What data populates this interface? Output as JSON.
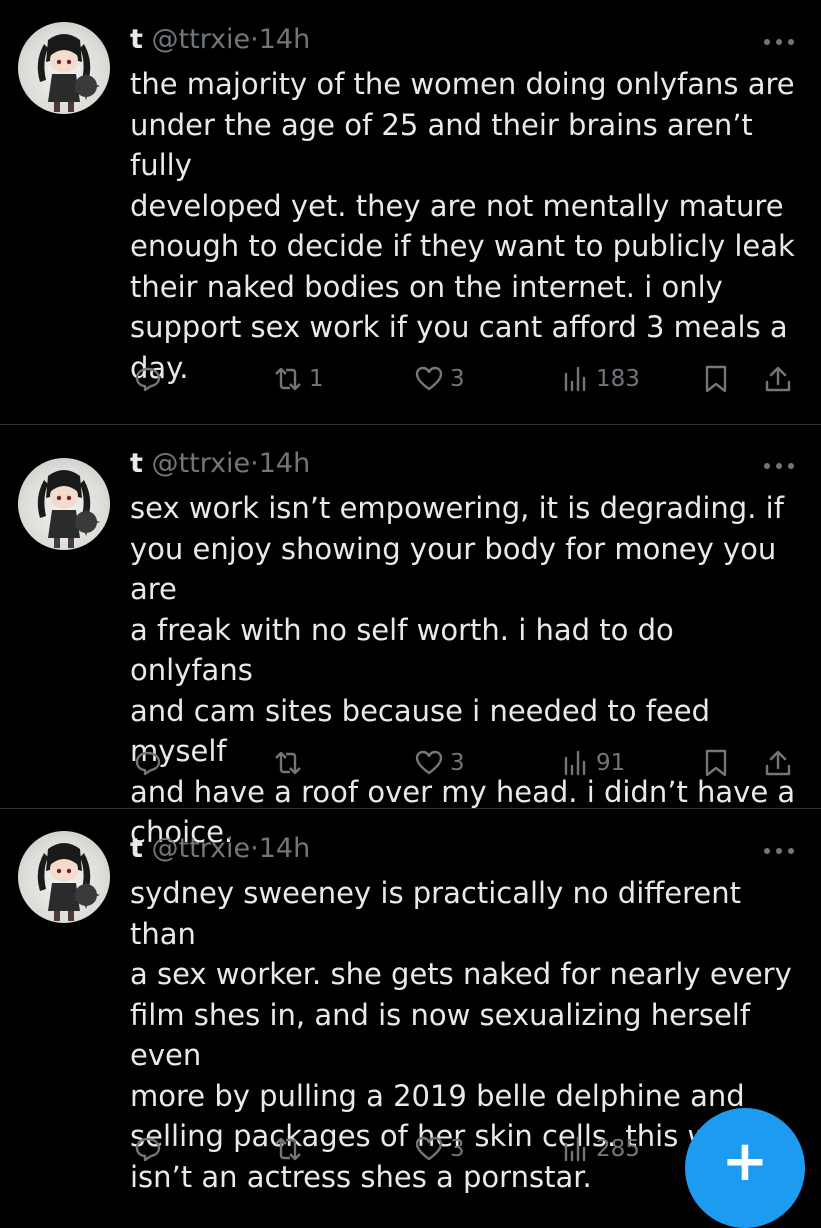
{
  "tweets": [
    {
      "name": "t",
      "handle": "@ttrxie",
      "sep": "·",
      "time": "14h",
      "text": "the majority of the women doing onlyfans are\nunder the age of 25 and their brains aren’t fully\ndeveloped yet. they are not mentally mature\nenough to decide if they want to publicly leak\ntheir naked bodies on the internet. i only\nsupport sex work if you cant afford 3 meals a\nday.",
      "replies": "",
      "reposts": "1",
      "likes": "3",
      "views": "183"
    },
    {
      "name": "t",
      "handle": "@ttrxie",
      "sep": "·",
      "time": "14h",
      "text": "sex work isn’t empowering, it is degrading. if\nyou enjoy showing your body for money you are\na freak with no self worth. i had to do onlyfans\nand cam sites because i needed to feed myself\nand have a roof over my head. i didn’t have a\nchoice.",
      "replies": "",
      "reposts": "",
      "likes": "3",
      "views": "91"
    },
    {
      "name": "t",
      "handle": "@ttrxie",
      "sep": "·",
      "time": "14h",
      "text": "sydney sweeney is practically no different than\na sex worker. she gets naked for nearly every\nfilm shes in, and is now sexualizing herself even\nmore by pulling a 2019 belle delphine and\nselling packages of her skin cells. this woman\nisn’t an actress shes a pornstar.",
      "replies": "",
      "reposts": "",
      "likes": "3",
      "views": "285"
    }
  ],
  "compose_button": {
    "icon": "plus-icon",
    "label": "+"
  },
  "colors": {
    "background": "#000000",
    "text": "#e7e9ea",
    "muted": "#71767b",
    "divider": "#2f3336",
    "accent": "#1d9bf0"
  }
}
